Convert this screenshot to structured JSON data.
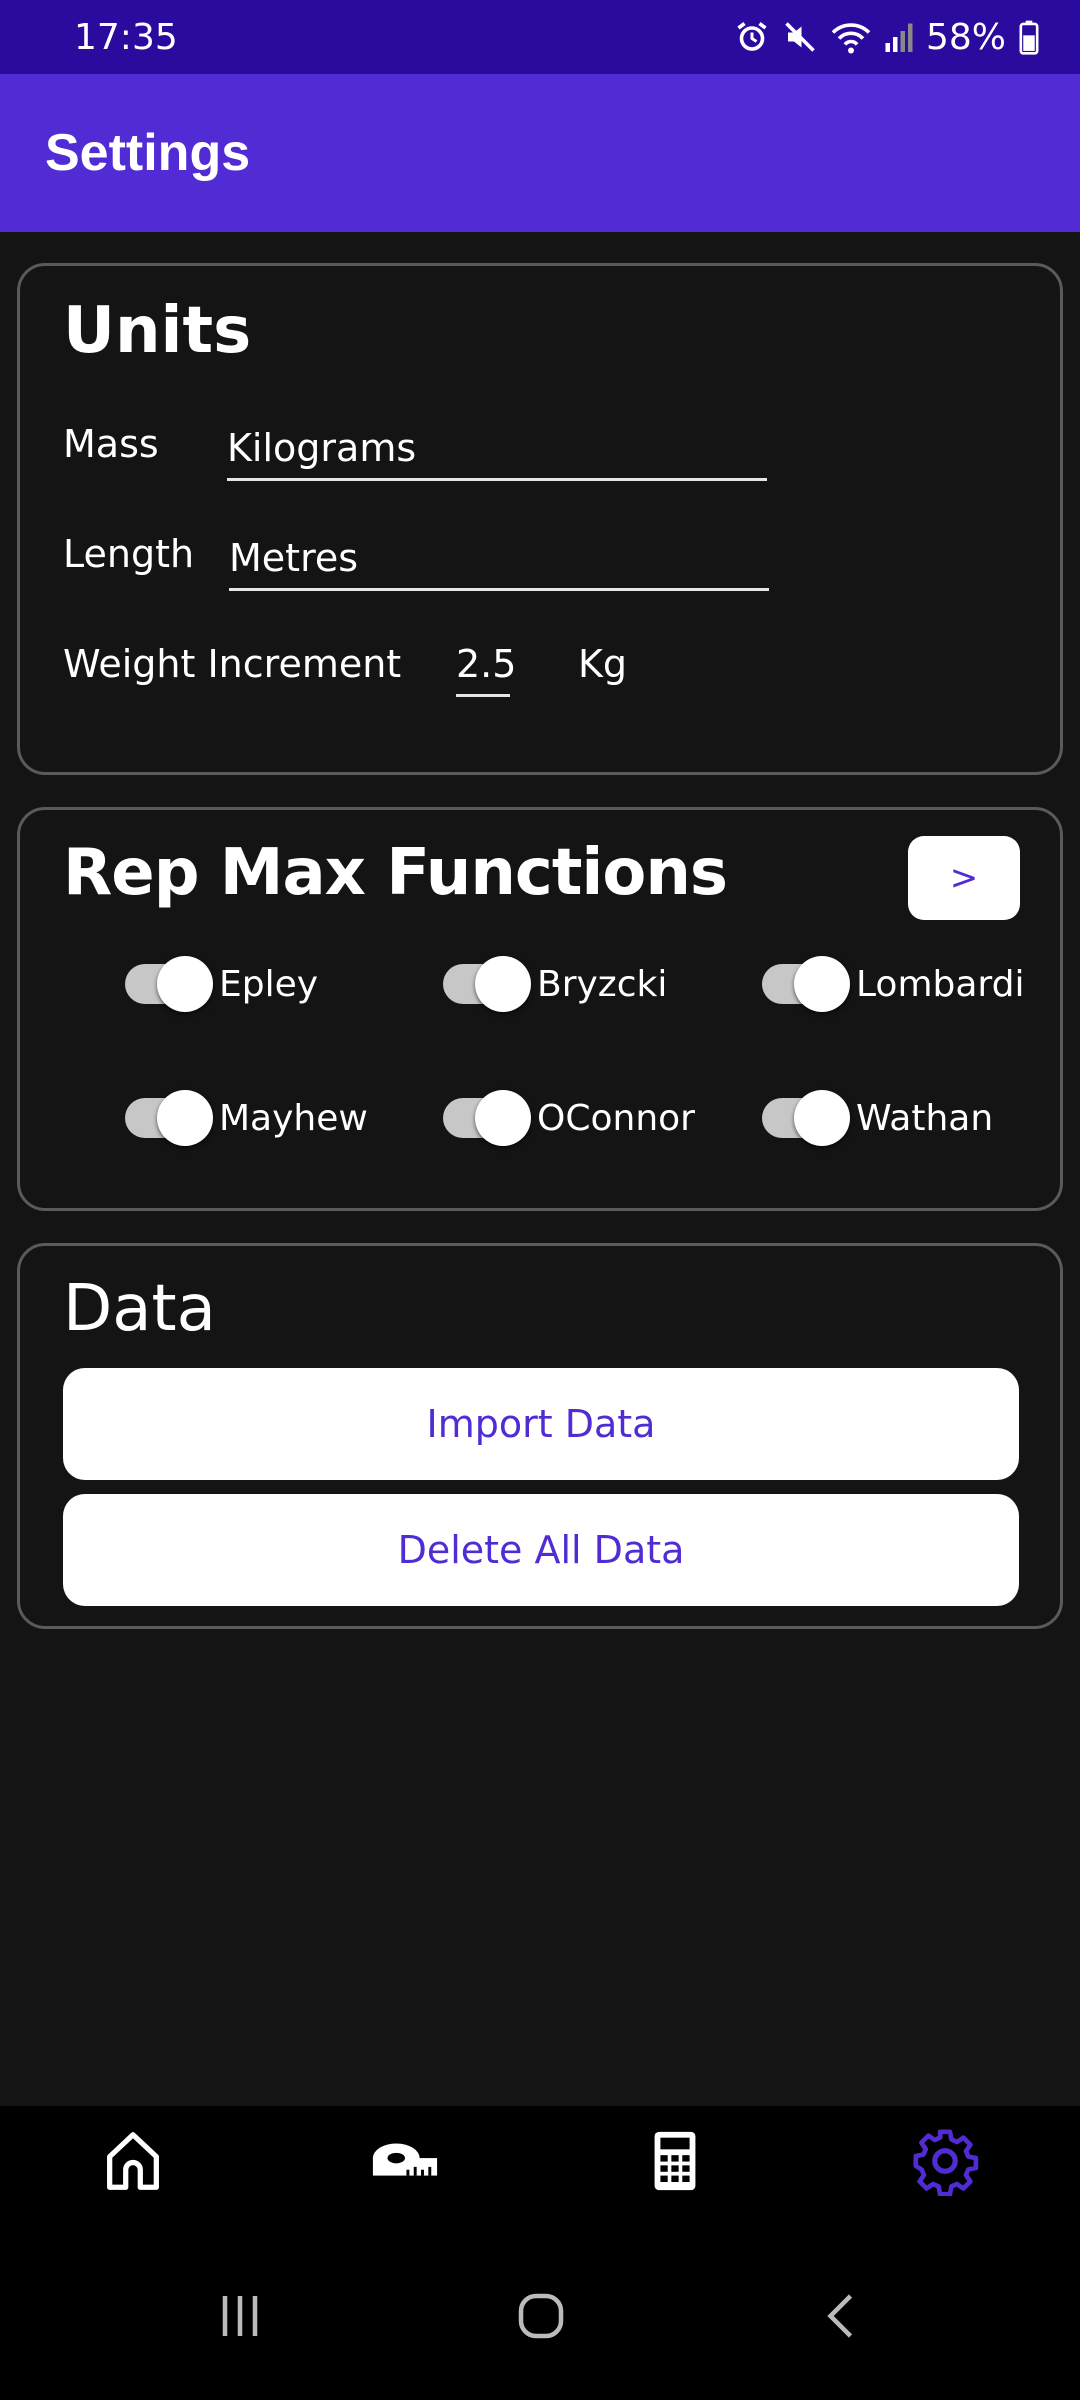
{
  "status_bar": {
    "time": "17:35",
    "battery": "58%"
  },
  "app_bar": {
    "title": "Settings"
  },
  "units": {
    "title": "Units",
    "mass_label": "Mass",
    "mass_value": "Kilograms",
    "length_label": "Length",
    "length_value": "Metres",
    "weight_increment_label": "Weight Increment",
    "weight_increment_value": "2.5",
    "weight_increment_unit": "Kg"
  },
  "rep_max": {
    "title": "Rep Max Functions",
    "next_label": ">",
    "functions": [
      {
        "name": "Epley",
        "enabled": true
      },
      {
        "name": "Bryzcki",
        "enabled": true
      },
      {
        "name": "Lombardi",
        "enabled": true
      },
      {
        "name": "Mayhew",
        "enabled": true
      },
      {
        "name": "OConnor",
        "enabled": true
      },
      {
        "name": "Wathan",
        "enabled": true
      }
    ]
  },
  "data_section": {
    "title": "Data",
    "import_label": "Import Data",
    "delete_label": "Delete All Data"
  },
  "bottom_nav": {
    "items": [
      "home-icon",
      "tape-measure-icon",
      "calculator-icon",
      "gear-icon"
    ],
    "active": "gear-icon",
    "active_color": "#512bd4"
  },
  "colors": {
    "status_bar": "#2a0b9e",
    "app_bar": "#512bd4",
    "background": "#141414",
    "accent": "#512bd4"
  }
}
